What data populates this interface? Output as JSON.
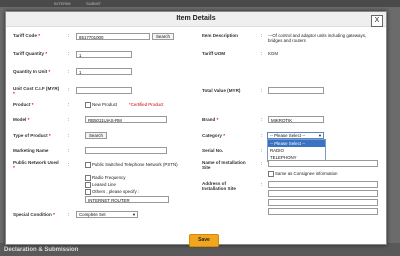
{
  "background": {
    "top_strip": [
      "INTERIM",
      "SUBMIT"
    ],
    "footer": "Declaration & Submission"
  },
  "dialog": {
    "title": "Item Details",
    "close_label": "X"
  },
  "fields": {
    "tariff_code": {
      "label": "Tariff Code",
      "value": "8517701000",
      "button": "Search"
    },
    "item_description": {
      "label": "Item Description",
      "value": "---Of control and adaptor units including gateways, bridges and routers"
    },
    "tariff_quantity": {
      "label": "Tariff Quantity",
      "value": "1"
    },
    "tariff_uom": {
      "label": "Tariff UOM",
      "value": "KGM"
    },
    "quantity_in_unit": {
      "label": "Quantity In Unit",
      "value": "1"
    },
    "unit_cost": {
      "label": "Unit Cost C.I.F (MYR)",
      "value": ""
    },
    "total_value": {
      "label": "Total Value (MYR)",
      "value": ""
    },
    "product": {
      "label": "Product",
      "option": "New Product",
      "note": "*Certified Product"
    },
    "model": {
      "label": "Model",
      "value": "RB5011UiAS-RM"
    },
    "brand": {
      "label": "Brand",
      "value": "MIKROTIK"
    },
    "type_of_product": {
      "label": "Type of Product",
      "button": "Search"
    },
    "category": {
      "label": "Category",
      "selected": "-- Please Select --",
      "options": [
        "-- Please Select --",
        "RADIO",
        "TELEPHONY"
      ]
    },
    "marketing_name": {
      "label": "Marketing Name",
      "value": ""
    },
    "serial_no": {
      "label": "Serial No.",
      "value": ""
    },
    "public_network": {
      "label": "Public Network Used",
      "options": [
        "Public Switched Telephone Network (PSTN)",
        "Radio Frequency",
        "Leased Line",
        "Others , please specify :"
      ],
      "other_value": "INTERNET ROUTER"
    },
    "installation_site_name": {
      "label": "Name of Installation Site",
      "value": ""
    },
    "same_as_consignee": {
      "label": "Same as Consignee information"
    },
    "installation_address": {
      "label": "Address of Installation Site",
      "lines": [
        "",
        "",
        "",
        ""
      ]
    },
    "special_condition": {
      "label": "Special Condition",
      "selected": "Complete Set"
    }
  },
  "save_label": "Save"
}
